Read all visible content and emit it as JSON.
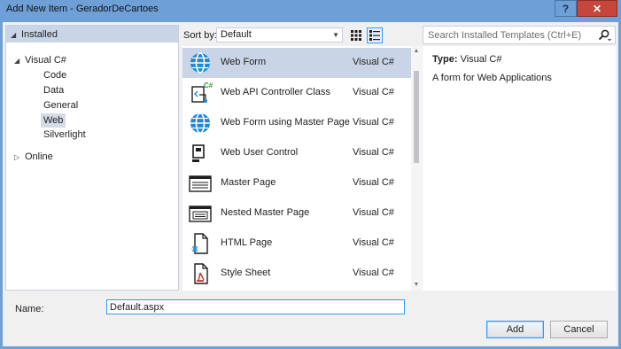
{
  "window": {
    "title": "Add New Item - GeradorDeCartoes",
    "help_label": "?",
    "close_label": "✕"
  },
  "tree": {
    "header": "Installed",
    "items": [
      {
        "label": "Visual C#",
        "arrow": "◢",
        "selected": false
      },
      {
        "label": "Code",
        "selected": false
      },
      {
        "label": "Data",
        "selected": false
      },
      {
        "label": "General",
        "selected": false
      },
      {
        "label": "Web",
        "selected": true
      },
      {
        "label": "Silverlight",
        "selected": false
      },
      {
        "label": "Online",
        "arrow": "▷",
        "selected": false
      }
    ]
  },
  "sort": {
    "label": "Sort by:",
    "value": "Default",
    "caret": "▼",
    "view_modes": [
      "grid-view-icon",
      "list-view-icon"
    ],
    "active_view": "list"
  },
  "templates": [
    {
      "name": "Web Form",
      "language": "Visual C#",
      "icon": "globe-icon",
      "selected": true
    },
    {
      "name": "Web API Controller Class",
      "language": "Visual C#",
      "icon": "webapi-icon",
      "selected": false
    },
    {
      "name": "Web Form using Master Page",
      "language": "Visual C#",
      "icon": "globe-icon",
      "selected": false
    },
    {
      "name": "Web User Control",
      "language": "Visual C#",
      "icon": "user-control-icon",
      "selected": false
    },
    {
      "name": "Master Page",
      "language": "Visual C#",
      "icon": "master-page-icon",
      "selected": false
    },
    {
      "name": "Nested Master Page",
      "language": "Visual C#",
      "icon": "nested-master-page-icon",
      "selected": false
    },
    {
      "name": "HTML Page",
      "language": "Visual C#",
      "icon": "html-page-icon",
      "selected": false
    },
    {
      "name": "Style Sheet",
      "language": "Visual C#",
      "icon": "style-sheet-icon",
      "selected": false
    }
  ],
  "search": {
    "placeholder": "Search Installed Templates (Ctrl+E)",
    "icon": "search-icon"
  },
  "details": {
    "type_key": "Type:",
    "type_value": "Visual C#",
    "description": "A form for Web Applications"
  },
  "footer": {
    "name_label": "Name:",
    "name_value": "Default.aspx",
    "add_label": "Add",
    "cancel_label": "Cancel"
  },
  "colors": {
    "title_bar": "#6e9fd6",
    "close_button": "#c7463b",
    "selection": "#c9d5e7",
    "globe_blue": "#1e88d6",
    "focus_border": "#3399ff"
  }
}
